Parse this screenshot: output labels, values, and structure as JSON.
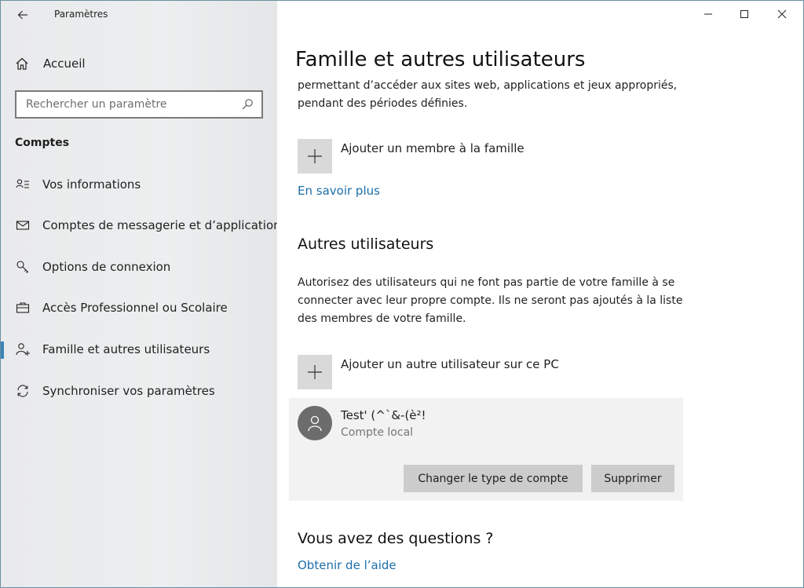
{
  "window": {
    "title": "Paramètres"
  },
  "sidebar": {
    "home_label": "Accueil",
    "search_placeholder": "Rechercher un paramètre",
    "section_label": "Comptes",
    "items": [
      {
        "label": "Vos informations",
        "icon": "person-card-icon"
      },
      {
        "label": "Comptes de messagerie et d’application",
        "icon": "mail-icon"
      },
      {
        "label": "Options de connexion",
        "icon": "key-icon"
      },
      {
        "label": "Accès Professionnel ou Scolaire",
        "icon": "briefcase-icon"
      },
      {
        "label": "Famille et autres utilisateurs",
        "icon": "person-add-icon",
        "active": true
      },
      {
        "label": "Synchroniser vos paramètres",
        "icon": "sync-icon"
      }
    ]
  },
  "main": {
    "title": "Famille et autres utilisateurs",
    "family_text": "permettant d’accéder aux sites web, applications et jeux appropriés, pendant des périodes définies.",
    "add_family_label": "Ajouter un membre à la famille",
    "learn_more": "En savoir plus",
    "other_users_heading": "Autres utilisateurs",
    "other_users_text": "Autorisez des utilisateurs qui ne font pas partie de votre famille à se connecter avec leur propre compte. Ils ne seront pas ajoutés à la liste des membres de votre famille.",
    "add_user_label": "Ajouter un autre utilisateur sur ce PC",
    "user": {
      "name": "Test' (^`&-(è²!",
      "type": "Compte local",
      "change_type_button": "Changer le type de compte",
      "delete_button": "Supprimer"
    },
    "questions_heading": "Vous avez des questions ?",
    "help_link": "Obtenir de l’aide"
  },
  "colors": {
    "accent": "#3a85b8",
    "link": "#1e6fa8",
    "sidebar_bg": "#eceeef",
    "tile_bg": "#d9d9d9",
    "card_bg": "#f2f2f2"
  }
}
